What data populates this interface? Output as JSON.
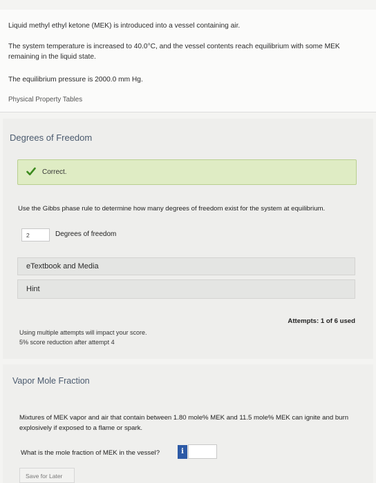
{
  "problem": {
    "intro": "Liquid methyl ethyl ketone (MEK) is introduced into a vessel containing air.",
    "system": "The system temperature is increased to 40.0°C, and the vessel contents reach equilibrium with some MEK remaining in the liquid state.",
    "pressure": "The equilibrium pressure is 2000.0 mm Hg.",
    "tables_link": "Physical Property Tables"
  },
  "part1": {
    "title": "Degrees of Freedom",
    "feedback": "Correct.",
    "question": "Use the Gibbs phase rule to determine how many degrees of freedom exist for the system at equilibrium.",
    "answer_value": "2",
    "answer_label": "Degrees of freedom",
    "ebook_label": "eTextbook and Media",
    "hint_label": "Hint",
    "attempts_label": "Attempts:",
    "attempts_count": "1 of 6 used",
    "attempt_note_1": "Using multiple attempts will impact your score.",
    "attempt_note_2": "5% score reduction after attempt 4"
  },
  "part2": {
    "title": "Vapor Mole Fraction",
    "mixture_text": "Mixtures of MEK vapor and air that contain between 1.80 mole% MEK and 11.5 mole% MEK can ignite and burn explosively if exposed to a flame or spark.",
    "question": "What is the mole fraction of MEK in the vessel?",
    "info_glyph": "i",
    "answer_value": "",
    "save_label": "Save for Later"
  },
  "colors": {
    "correct_bg": "#dfecc4",
    "check_green": "#3c8a1e",
    "info_blue": "#2d5aa6",
    "title_blue_gray": "#4a5a6e"
  },
  "icons": [
    "checkmark-icon",
    "info-icon"
  ]
}
